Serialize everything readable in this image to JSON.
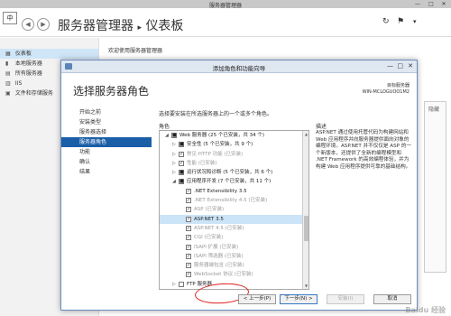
{
  "window": {
    "title": "服务器管理器",
    "controls": [
      "—",
      "□",
      "✕"
    ]
  },
  "header": {
    "corner_label": "中",
    "breadcrumb_app": "服务器管理器",
    "breadcrumb_sep": "▸",
    "breadcrumb_page": "仪表板"
  },
  "sidebar": {
    "items": [
      {
        "label": "仪表板",
        "icon": "▦"
      },
      {
        "label": "本地服务器",
        "icon": "▮"
      },
      {
        "label": "所有服务器",
        "icon": "▤"
      },
      {
        "label": "IIS",
        "icon": "▥"
      },
      {
        "label": "文件和存储服务",
        "icon": "▣"
      }
    ]
  },
  "main": {
    "welcome": "欢迎使用服务器管理器",
    "rightbox_label": "隐藏"
  },
  "dialog": {
    "title": "添加角色和功能向导",
    "heading": "选择服务器角色",
    "target_label": "目标服务器",
    "target_server": "WIN-MCLOGUOO1M2",
    "instruction": "选择要安装在所选服务器上的一个或多个角色。",
    "roles_label": "角色",
    "description_label": "描述",
    "steps": [
      "开始之前",
      "安装类型",
      "服务器选择",
      "服务器角色",
      "功能",
      "确认",
      "结果"
    ],
    "tree": [
      {
        "label": "Web 服务器 (25 个已安装，共 34 个)",
        "indent": 0,
        "expander": "◢",
        "check": "■",
        "dim": false
      },
      {
        "label": "安全性 (5 个已安装，共 9 个)",
        "indent": 1,
        "expander": "▷",
        "check": "■",
        "dim": false
      },
      {
        "label": "常见 HTTP 功能 (已安装)",
        "indent": 1,
        "expander": "▷",
        "check": "✓",
        "dim": true
      },
      {
        "label": "性能 (已安装)",
        "indent": 1,
        "expander": "▷",
        "check": "✓",
        "dim": true
      },
      {
        "label": "运行状况和诊断 (5 个已安装，共 6 个)",
        "indent": 1,
        "expander": "▷",
        "check": "■",
        "dim": false
      },
      {
        "label": "应用程序开发 (7 个已安装，共 11 个)",
        "indent": 1,
        "expander": "◢",
        "check": "■",
        "dim": false
      },
      {
        "label": ".NET Extensibility 3.5",
        "indent": 2,
        "expander": "",
        "check": "✓",
        "dim": false
      },
      {
        "label": ".NET Extensibility 4.5 (已安装)",
        "indent": 2,
        "expander": "",
        "check": "✓",
        "dim": true
      },
      {
        "label": "ASP (已安装)",
        "indent": 2,
        "expander": "",
        "check": "✓",
        "dim": true
      },
      {
        "label": "ASP.NET 3.5",
        "indent": 2,
        "expander": "",
        "check": "✓",
        "dim": false,
        "selected": true
      },
      {
        "label": "ASP.NET 4.5 (已安装)",
        "indent": 2,
        "expander": "",
        "check": "✓",
        "dim": true
      },
      {
        "label": "CGI (已安装)",
        "indent": 2,
        "expander": "",
        "check": "✓",
        "dim": true
      },
      {
        "label": "ISAPI 扩展 (已安装)",
        "indent": 2,
        "expander": "",
        "check": "✓",
        "dim": true
      },
      {
        "label": "ISAPI 筛选器 (已安装)",
        "indent": 2,
        "expander": "",
        "check": "✓",
        "dim": true
      },
      {
        "label": "服务器端包含 (已安装)",
        "indent": 2,
        "expander": "",
        "check": "✓",
        "dim": true
      },
      {
        "label": "WebSocket 协议 (已安装)",
        "indent": 2,
        "expander": "",
        "check": "✓",
        "dim": true
      },
      {
        "label": "FTP 服务器",
        "indent": 1,
        "expander": "▷",
        "check": "",
        "dim": false
      }
    ],
    "description": "ASP.NET 通过使用托管代码为构建网站和 Web 应用程序并向服务器提供面向对象的编程环境。ASP.NET 并不仅仅是 ASP 的一个新版本，还提供了全新的编程模型和 .NET Framework 的高效编程体验，并为构建 Web 应用程序提供可靠的基础结构。",
    "buttons": {
      "prev": "< 上一步(P)",
      "next": "下一步(N) >",
      "install": "安装(I)",
      "cancel": "取消"
    }
  },
  "watermark": "Baidu 经验"
}
